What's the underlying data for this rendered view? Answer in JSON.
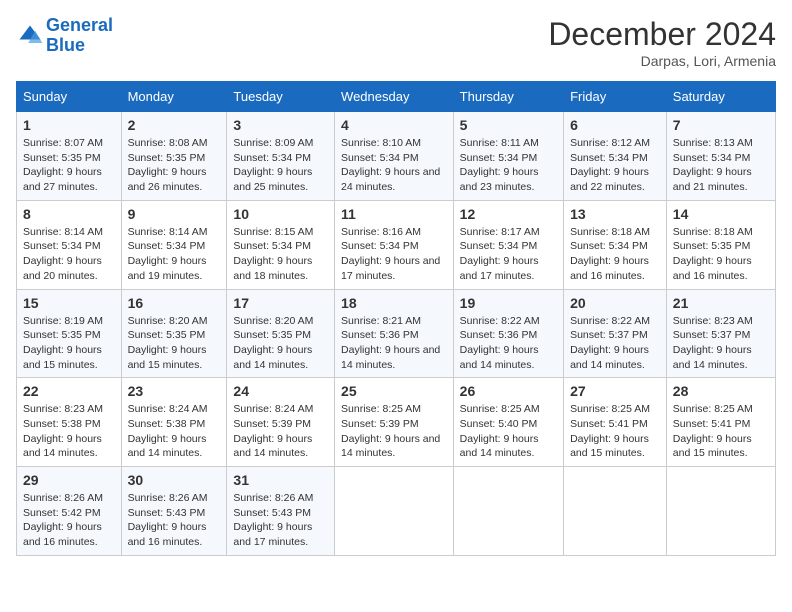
{
  "header": {
    "logo_line1": "General",
    "logo_line2": "Blue",
    "month": "December 2024",
    "location": "Darpas, Lori, Armenia"
  },
  "weekdays": [
    "Sunday",
    "Monday",
    "Tuesday",
    "Wednesday",
    "Thursday",
    "Friday",
    "Saturday"
  ],
  "weeks": [
    [
      {
        "day": "1",
        "rise": "8:07 AM",
        "set": "5:35 PM",
        "daylight": "9 hours and 27 minutes."
      },
      {
        "day": "2",
        "rise": "8:08 AM",
        "set": "5:35 PM",
        "daylight": "9 hours and 26 minutes."
      },
      {
        "day": "3",
        "rise": "8:09 AM",
        "set": "5:34 PM",
        "daylight": "9 hours and 25 minutes."
      },
      {
        "day": "4",
        "rise": "8:10 AM",
        "set": "5:34 PM",
        "daylight": "9 hours and 24 minutes."
      },
      {
        "day": "5",
        "rise": "8:11 AM",
        "set": "5:34 PM",
        "daylight": "9 hours and 23 minutes."
      },
      {
        "day": "6",
        "rise": "8:12 AM",
        "set": "5:34 PM",
        "daylight": "9 hours and 22 minutes."
      },
      {
        "day": "7",
        "rise": "8:13 AM",
        "set": "5:34 PM",
        "daylight": "9 hours and 21 minutes."
      }
    ],
    [
      {
        "day": "8",
        "rise": "8:14 AM",
        "set": "5:34 PM",
        "daylight": "9 hours and 20 minutes."
      },
      {
        "day": "9",
        "rise": "8:14 AM",
        "set": "5:34 PM",
        "daylight": "9 hours and 19 minutes."
      },
      {
        "day": "10",
        "rise": "8:15 AM",
        "set": "5:34 PM",
        "daylight": "9 hours and 18 minutes."
      },
      {
        "day": "11",
        "rise": "8:16 AM",
        "set": "5:34 PM",
        "daylight": "9 hours and 17 minutes."
      },
      {
        "day": "12",
        "rise": "8:17 AM",
        "set": "5:34 PM",
        "daylight": "9 hours and 17 minutes."
      },
      {
        "day": "13",
        "rise": "8:18 AM",
        "set": "5:34 PM",
        "daylight": "9 hours and 16 minutes."
      },
      {
        "day": "14",
        "rise": "8:18 AM",
        "set": "5:35 PM",
        "daylight": "9 hours and 16 minutes."
      }
    ],
    [
      {
        "day": "15",
        "rise": "8:19 AM",
        "set": "5:35 PM",
        "daylight": "9 hours and 15 minutes."
      },
      {
        "day": "16",
        "rise": "8:20 AM",
        "set": "5:35 PM",
        "daylight": "9 hours and 15 minutes."
      },
      {
        "day": "17",
        "rise": "8:20 AM",
        "set": "5:35 PM",
        "daylight": "9 hours and 14 minutes."
      },
      {
        "day": "18",
        "rise": "8:21 AM",
        "set": "5:36 PM",
        "daylight": "9 hours and 14 minutes."
      },
      {
        "day": "19",
        "rise": "8:22 AM",
        "set": "5:36 PM",
        "daylight": "9 hours and 14 minutes."
      },
      {
        "day": "20",
        "rise": "8:22 AM",
        "set": "5:37 PM",
        "daylight": "9 hours and 14 minutes."
      },
      {
        "day": "21",
        "rise": "8:23 AM",
        "set": "5:37 PM",
        "daylight": "9 hours and 14 minutes."
      }
    ],
    [
      {
        "day": "22",
        "rise": "8:23 AM",
        "set": "5:38 PM",
        "daylight": "9 hours and 14 minutes."
      },
      {
        "day": "23",
        "rise": "8:24 AM",
        "set": "5:38 PM",
        "daylight": "9 hours and 14 minutes."
      },
      {
        "day": "24",
        "rise": "8:24 AM",
        "set": "5:39 PM",
        "daylight": "9 hours and 14 minutes."
      },
      {
        "day": "25",
        "rise": "8:25 AM",
        "set": "5:39 PM",
        "daylight": "9 hours and 14 minutes."
      },
      {
        "day": "26",
        "rise": "8:25 AM",
        "set": "5:40 PM",
        "daylight": "9 hours and 14 minutes."
      },
      {
        "day": "27",
        "rise": "8:25 AM",
        "set": "5:41 PM",
        "daylight": "9 hours and 15 minutes."
      },
      {
        "day": "28",
        "rise": "8:25 AM",
        "set": "5:41 PM",
        "daylight": "9 hours and 15 minutes."
      }
    ],
    [
      {
        "day": "29",
        "rise": "8:26 AM",
        "set": "5:42 PM",
        "daylight": "9 hours and 16 minutes."
      },
      {
        "day": "30",
        "rise": "8:26 AM",
        "set": "5:43 PM",
        "daylight": "9 hours and 16 minutes."
      },
      {
        "day": "31",
        "rise": "8:26 AM",
        "set": "5:43 PM",
        "daylight": "9 hours and 17 minutes."
      },
      null,
      null,
      null,
      null
    ]
  ]
}
